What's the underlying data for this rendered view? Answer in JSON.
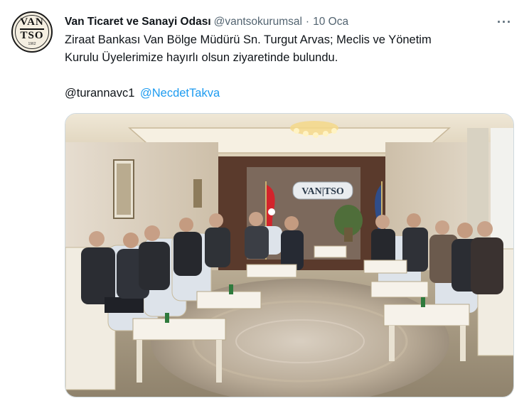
{
  "tweet": {
    "avatar_label": {
      "top": "VAN",
      "bottom": "TSO",
      "year": "1962"
    },
    "display_name": "Van Ticaret ve Sanayi Odası",
    "handle": "@vantsokurumsal",
    "separator": "·",
    "timestamp": "10 Oca",
    "more_icon": "···",
    "text_line1": "Ziraat Bankası Van Bölge Müdürü Sn. Turgut Arvas; Meclis ve Yönetim",
    "text_line2": "Kurulu Üyelerimize hayırlı olsun ziyaretinde bulundu.",
    "mention_1": "@turannavc1",
    "mention_2": "@NecdetTakva",
    "photo": {
      "wall_logo": "VAN|TSO"
    }
  },
  "colors": {
    "link": "#1d9bf0",
    "secondary_text": "#536471"
  }
}
